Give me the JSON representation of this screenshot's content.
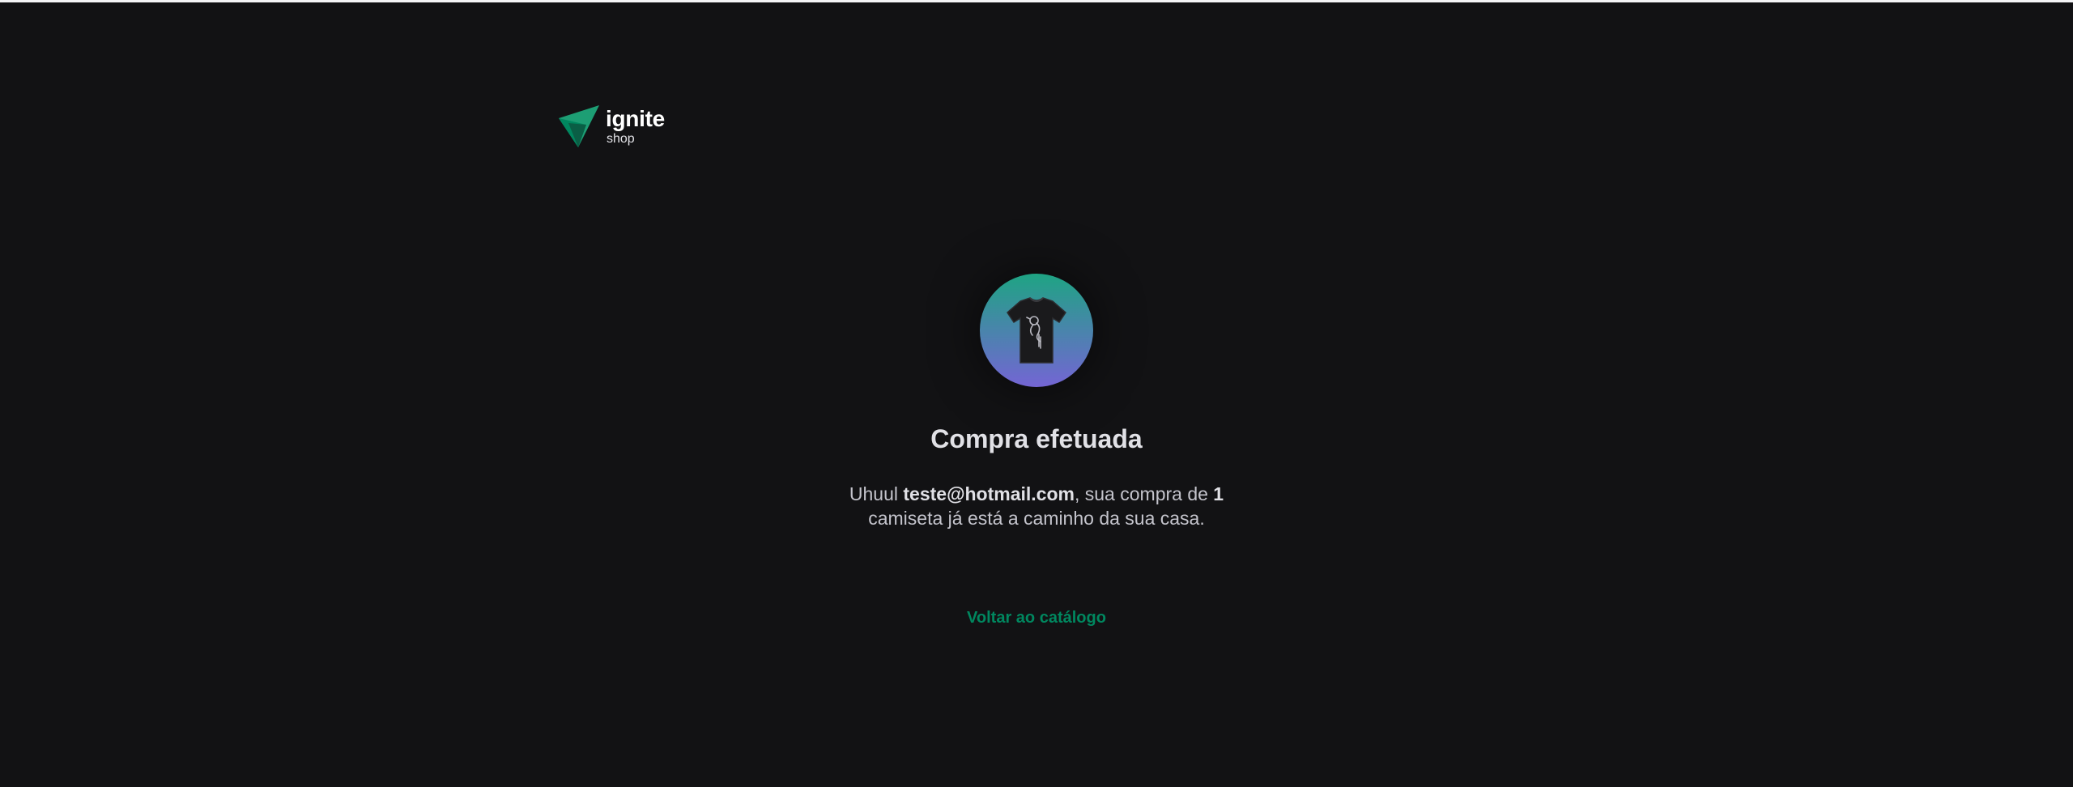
{
  "header": {
    "logo_name": "ignite",
    "logo_sub": "shop"
  },
  "success": {
    "title": "Compra efetuada",
    "greeting": "Uhuul",
    "customer_email": "teste@hotmail.com",
    "mid_text": ", sua compra de",
    "quantity": "1",
    "tail_text": "camiseta já está a caminho da sua casa.",
    "back_link": "Voltar ao catálogo"
  },
  "colors": {
    "background": "#121214",
    "brand_green": "#00875f",
    "gradient_start": "#1ea483",
    "gradient_end": "#7465d4"
  },
  "icons": {
    "logo": "ignite-logo-icon",
    "product": "tshirt-icon"
  }
}
